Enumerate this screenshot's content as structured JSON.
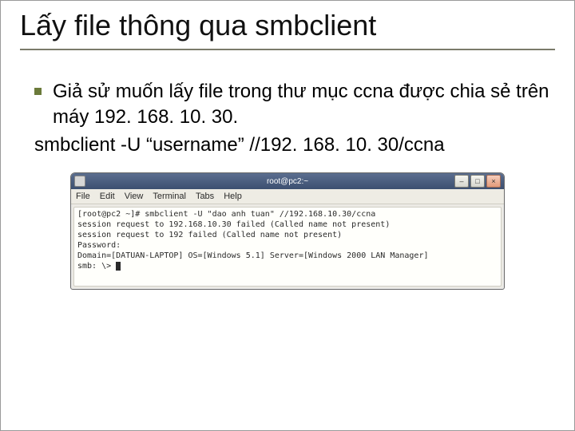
{
  "title": "Lấy file thông qua smbclient",
  "bullet": "Giả sử muốn lấy file trong thư mục ccna được chia sẻ trên máy 192. 168. 10. 30.",
  "command": "smbclient -U “username” //192. 168. 10. 30/ccna",
  "terminal": {
    "window_title": "root@pc2:~",
    "menu": {
      "file": "File",
      "edit": "Edit",
      "view": "View",
      "terminal": "Terminal",
      "tabs": "Tabs",
      "help": "Help"
    },
    "buttons": {
      "minimize": "–",
      "maximize": "□",
      "close": "×"
    },
    "lines": [
      "[root@pc2 ~]# smbclient -U \"dao anh tuan\" //192.168.10.30/ccna",
      "session request to 192.168.10.30 failed (Called name not present)",
      "session request to 192 failed (Called name not present)",
      "Password:",
      "Domain=[DATUAN-LAPTOP] OS=[Windows 5.1] Server=[Windows 2000 LAN Manager]",
      "smb: \\> "
    ]
  }
}
